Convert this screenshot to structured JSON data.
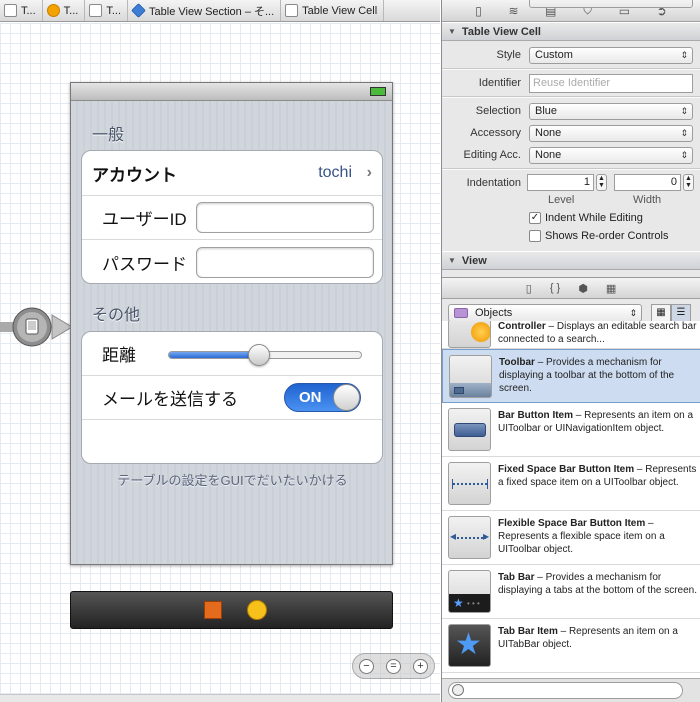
{
  "breadcrumb": {
    "items": [
      "T...",
      "T...",
      "T...",
      "Table View Section – そ...",
      "Table View Cell"
    ]
  },
  "phone": {
    "section1_header": "一般",
    "account_label": "アカウント",
    "account_value": "tochi",
    "userid_label": "ユーザーID",
    "password_label": "パスワード",
    "section2_header": "その他",
    "distance_label": "距離",
    "distance_slider_value": 0.47,
    "mail_label": "メールを送信する",
    "mail_toggle": "ON",
    "footer": "テーブルの設定をGUIでだいたいかける"
  },
  "inspector": {
    "header": "Table View Cell",
    "style_label": "Style",
    "style_value": "Custom",
    "identifier_label": "Identifier",
    "identifier_placeholder": "Reuse Identifier",
    "selection_label": "Selection",
    "selection_value": "Blue",
    "accessory_label": "Accessory",
    "accessory_value": "None",
    "editing_acc_label": "Editing Acc.",
    "editing_acc_value": "None",
    "indentation_label": "Indentation",
    "level_value": "1",
    "width_value": "0",
    "level_label": "Level",
    "width_label": "Width",
    "indent_while_editing": "Indent While Editing",
    "show_reorder": "Shows Re-order Controls",
    "view_header": "View"
  },
  "library": {
    "filter": "Objects",
    "items": [
      {
        "name": "Controller",
        "desc": " – Displays an editable search bar connected to a search..."
      },
      {
        "name": "Toolbar",
        "desc": " – Provides a mechanism for displaying a toolbar at the bottom of the screen."
      },
      {
        "name": "Bar Button Item",
        "desc": " – Represents an item on a UIToolbar or UINavigationItem object."
      },
      {
        "name": "Fixed Space Bar Button Item",
        "desc": " – Represents a fixed space item on a UIToolbar object."
      },
      {
        "name": "Flexible Space Bar Button Item",
        "desc": " – Represents a flexible space item on a UIToolbar object."
      },
      {
        "name": "Tab Bar",
        "desc": " – Provides a mechanism for displaying a tabs at the bottom of the screen."
      },
      {
        "name": "Tab Bar Item",
        "desc": " – Represents an item on a UITabBar object."
      }
    ]
  },
  "colors": {
    "selection_blue": "#cddcf0",
    "toggle_on": "#2f7ae0",
    "section_text": "#4b566a"
  }
}
